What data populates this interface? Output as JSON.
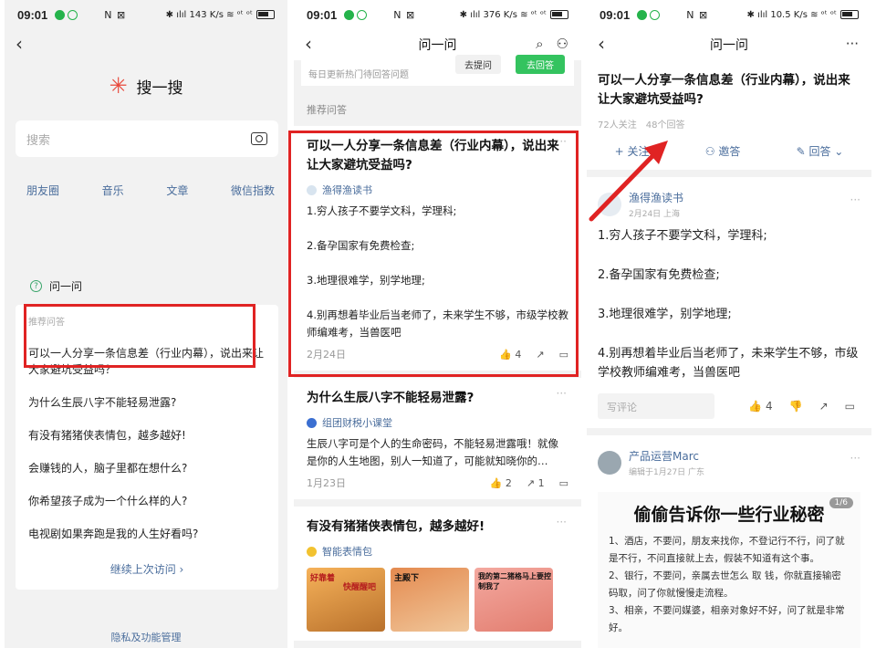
{
  "status": {
    "time": "09:01",
    "mid": "N ⊠",
    "right_p1": "✱ ılıl 143 K/s ≋ ᵒᵗ ᵒᵗ",
    "right_p2": "✱ ılıl 376 K/s ≋ ᵒᵗ ᵒᵗ",
    "right_p3": "✱ ılıl 10.5 K/s ≋ ᵒᵗ ᵒᵗ"
  },
  "search": {
    "brand_title": "搜一搜",
    "placeholder": "搜索",
    "categories": [
      "朋友圈",
      "音乐",
      "文章",
      "微信指数"
    ],
    "qa_heading": "问一问",
    "qa_subheading": "推荐问答",
    "items": [
      "可以一人分享一条信息差（行业内幕），说出来让大家避坑受益吗？",
      "为什么生辰八字不能轻易泄露?",
      "有没有猪猪侠表情包，越多越好!",
      "会赚钱的人，脑子里都在想什么?",
      "你希望孩子成为一个什么样的人?",
      "电视剧如果奔跑是我的人生好看吗?"
    ],
    "more_link": "继续上次访问 ›",
    "privacy": "隐私及功能管理"
  },
  "feed": {
    "title": "问一问",
    "daily_text": "每日更新热门待回答问题",
    "ask_button": "去提问",
    "answer_button": "去回答",
    "rec_label": "推荐问答",
    "cards": [
      {
        "title": "可以一人分享一条信息差（行业内幕），说出来让大家避坑受益吗?",
        "author": "渔得渔读书",
        "body": [
          "1.穷人孩子不要学文科，学理科;",
          "2.备孕国家有免费检查;",
          "3.地理很难学，别学地理;",
          "4.别再想着毕业后当老师了，未来学生不够，市级学校教师编难考，当兽医吧"
        ],
        "date": "2月24日",
        "likes": "4"
      },
      {
        "title": "为什么生辰八字不能轻易泄露?",
        "author": "组团财税小课堂",
        "body": [
          "生辰八字可是个人的生命密码，不能轻易泄露哦！就像是你的人生地图，别人一知道了，可能就知晓你的…"
        ],
        "date": "1月23日",
        "likes": "2",
        "shares": "1"
      },
      {
        "title": "有没有猪猪侠表情包，越多越好!",
        "author": "智能表情包",
        "memes": [
          "好靠着",
          "快醒醒吧",
          "主殿下",
          "我的第二猪格马上要控制我了"
        ]
      }
    ]
  },
  "detail": {
    "title": "问一问",
    "question": "可以一人分享一条信息差（行业内幕），说出来让大家避坑受益吗?",
    "followers": "72人关注",
    "answers": "48个回答",
    "follow_button": "+ 关注",
    "invite_button": "邀答",
    "answer_button": "回答 ⌄",
    "answer1": {
      "author": "渔得渔读书",
      "meta": "2月24日 上海",
      "body": [
        "1.穷人孩子不要学文科，学理科;",
        "2.备孕国家有免费检查;",
        "3.地理很难学，别学地理;",
        "4.别再想着毕业后当老师了，未来学生不够，市级学校教师编难考，当兽医吧"
      ],
      "comment_placeholder": "写评论",
      "likes": "4"
    },
    "answer2": {
      "author": "产品运营Marc",
      "meta": "编辑于1月27日 广东",
      "image_title": "偷偷告诉你一些行业秘密",
      "page_indicator": "1/6",
      "image_lines": [
        "1、酒店，不要问，朋友来找你，不登记行不行，问了就是不行，不问直接就上去，假装不知道有这个事。",
        "2、银行，不要问，亲属去世怎么 取 钱，你就直接输密码取，问了你就慢慢走流程。",
        "3、相亲，不要问媒婆，相亲对象好不好，问了就是非常好。"
      ]
    }
  },
  "colors": {
    "highlight": "#e02323",
    "wechat_green": "#34c35f",
    "link_blue": "#4a6d9c"
  }
}
